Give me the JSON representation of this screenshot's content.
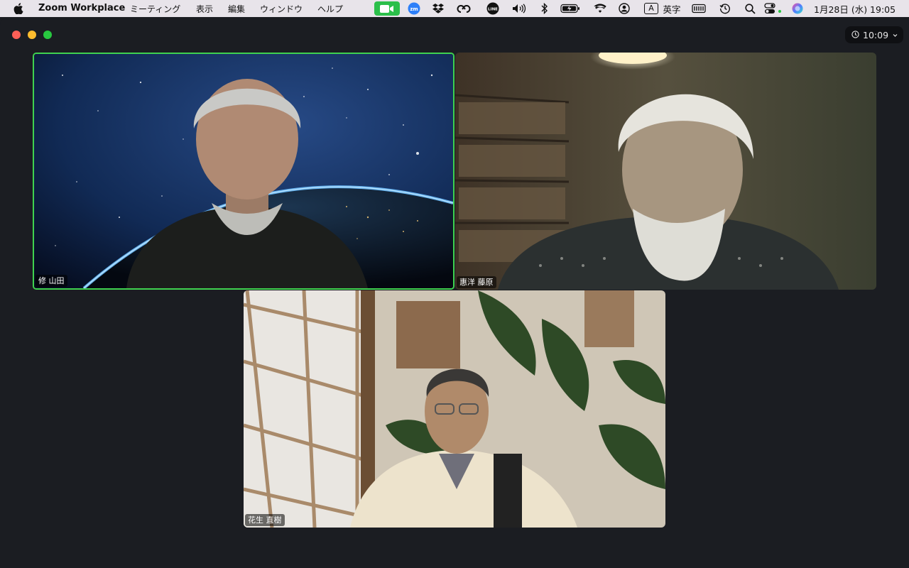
{
  "menubar": {
    "app_name": "Zoom Workplace",
    "menus": [
      "ミーティング",
      "表示",
      "編集",
      "ウィンドウ",
      "ヘルプ"
    ],
    "input_mode_letter": "A",
    "input_mode_label": "英字",
    "datetime": "1月28日 (水)  19:05"
  },
  "window": {
    "timer": "10:09"
  },
  "participants": [
    {
      "name": "修 山田",
      "active_speaker": true
    },
    {
      "name": "惠洋 藤原",
      "active_speaker": false
    },
    {
      "name": "花生 直樹",
      "active_speaker": false
    }
  ],
  "colors": {
    "active_speaker_border": "#3fd24f",
    "zoom_status_icon_bg": "#2bbf4a",
    "window_bg": "#1b1d22"
  }
}
